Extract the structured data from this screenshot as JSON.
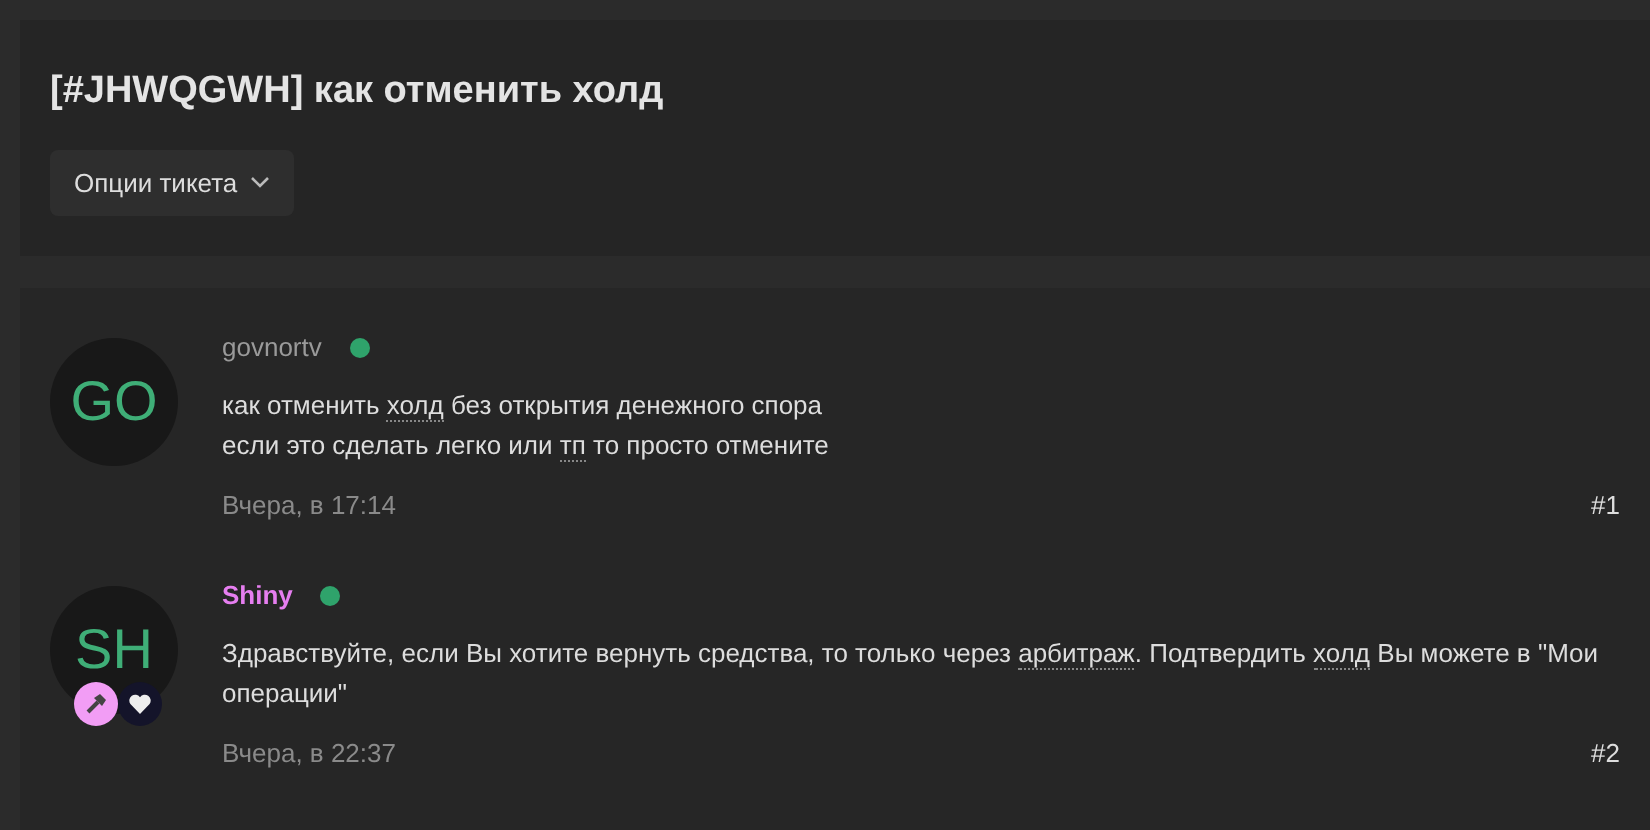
{
  "ticket": {
    "title": "[#JHWQGWH] как отменить холд",
    "options_button": "Опции тикета"
  },
  "posts": [
    {
      "initials": "GO",
      "author": "govnortv",
      "color": "#9a9a9a",
      "online": true,
      "lines": [
        [
          {
            "text": "как отменить ",
            "term": false
          },
          {
            "text": "холд",
            "term": true
          },
          {
            "text": " без открытия денежного спора",
            "term": false
          }
        ],
        [
          {
            "text": "если это сделать легко или ",
            "term": false
          },
          {
            "text": "тп",
            "term": true
          },
          {
            "text": " то просто отмените",
            "term": false
          }
        ]
      ],
      "time": "Вчера, в 17:14",
      "number": "#1"
    },
    {
      "initials": "SH",
      "author": "Shiny",
      "color": "#e67ef0",
      "online": true,
      "badges": [
        {
          "kind": "hammer"
        },
        {
          "kind": "heart"
        }
      ],
      "lines": [
        [
          {
            "text": "Здравствуйте, если Вы хотите вернуть средства, то только через ",
            "term": false
          },
          {
            "text": "арбитраж",
            "term": true
          },
          {
            "text": ". Подтвердить ",
            "term": false
          },
          {
            "text": "холд",
            "term": true
          },
          {
            "text": " Вы можете в \"Мои операции\"",
            "term": false
          }
        ]
      ],
      "time": "Вчера, в 22:37",
      "number": "#2"
    }
  ]
}
